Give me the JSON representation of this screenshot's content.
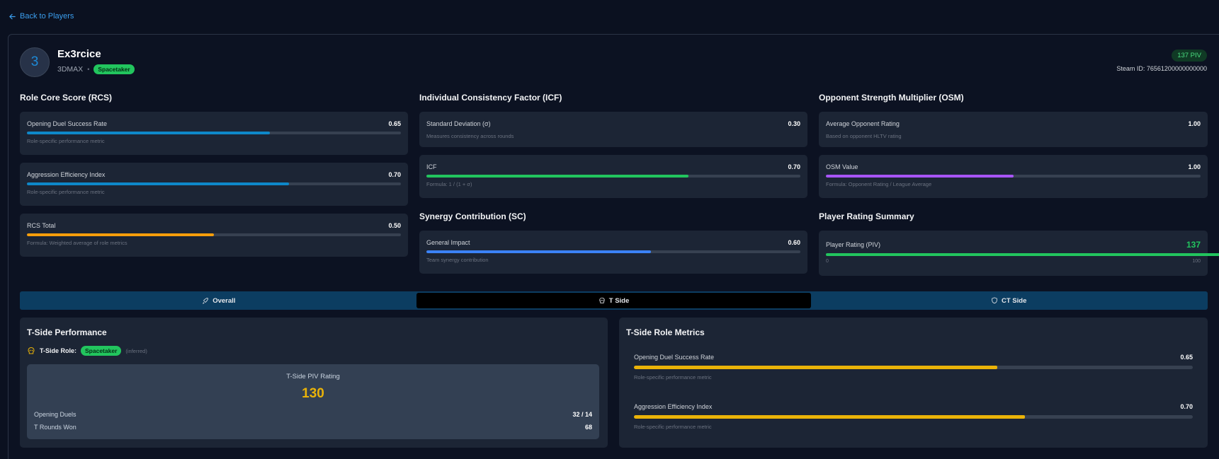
{
  "nav": {
    "back_label": "Back to Players"
  },
  "player": {
    "avatar_letter": "3",
    "name": "Ex3rcice",
    "team": "3DMAX",
    "separator": "•",
    "role": "Spacetaker",
    "piv_badge": "137 PIV",
    "steam_id": "Steam ID: 76561200000000000"
  },
  "rcs": {
    "title": "Role Core Score (RCS)",
    "metrics": [
      {
        "label": "Opening Duel Success Rate",
        "value": "0.65",
        "fill": 0.65,
        "note": "Role-specific performance metric"
      },
      {
        "label": "Aggression Efficiency Index",
        "value": "0.70",
        "fill": 0.7,
        "note": "Role-specific performance metric"
      },
      {
        "label": "RCS Total",
        "value": "0.50",
        "fill": 0.5,
        "note": "Formula: Weighted average of role metrics"
      }
    ]
  },
  "icf": {
    "title": "Individual Consistency Factor (ICF)",
    "metrics": [
      {
        "label": "Standard Deviation (σ)",
        "value": "0.30",
        "note": "Measures consistency across rounds"
      },
      {
        "label": "ICF",
        "value": "0.70",
        "fill": 0.7,
        "note": "Formula: 1 / (1 + σ)"
      }
    ]
  },
  "osm": {
    "title": "Opponent Strength Multiplier (OSM)",
    "metrics": [
      {
        "label": "Average Opponent Rating",
        "value": "1.00",
        "note": "Based on opponent HLTV rating"
      },
      {
        "label": "OSM Value",
        "value": "1.00",
        "fill": 0.5,
        "note": "Formula: Opponent Rating / League Average"
      }
    ]
  },
  "sc": {
    "title": "Synergy Contribution (SC)",
    "metrics": [
      {
        "label": "General Impact",
        "value": "0.60",
        "fill": 0.6,
        "note": "Team synergy contribution"
      }
    ]
  },
  "summary": {
    "title": "Player Rating Summary",
    "label": "Player Rating (PIV)",
    "value": "137",
    "min": "0",
    "max": "100"
  },
  "tabs": [
    {
      "label": "Overall",
      "icon": "rocket-icon"
    },
    {
      "label": "T Side",
      "icon": "skull-icon",
      "active": true
    },
    {
      "label": "CT Side",
      "icon": "shield-icon"
    }
  ],
  "t_perf": {
    "title": "T-Side Performance",
    "role_label": "T-Side Role:",
    "role": "Spacetaker",
    "inferred": "(inferred)",
    "rating_title": "T-Side PIV Rating",
    "rating_value": "130",
    "stats": [
      {
        "label": "Opening Duels",
        "value": "32 / 14"
      },
      {
        "label": "T Rounds Won",
        "value": "68"
      }
    ]
  },
  "t_role": {
    "title": "T-Side Role Metrics",
    "metrics": [
      {
        "label": "Opening Duel Success Rate",
        "value": "0.65",
        "fill": 0.65,
        "note": "Role-specific performance metric"
      },
      {
        "label": "Aggression Efficiency Index",
        "value": "0.70",
        "fill": 0.7,
        "note": "Role-specific performance metric"
      }
    ]
  },
  "colors": {
    "blue_bar": "#0e88c9",
    "orange_bar": "#f59e0b",
    "green_bar": "#22c55e",
    "purple_bar": "#a855f7",
    "indigo_bar": "#3b82f6",
    "yellow_bar": "#eab308"
  }
}
